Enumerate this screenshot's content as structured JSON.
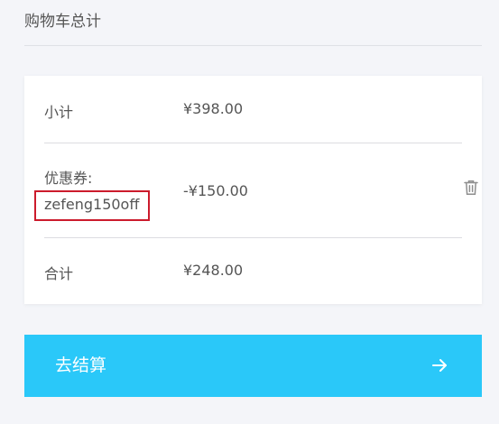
{
  "header": {
    "title": "购物车总计"
  },
  "totals": {
    "subtotal_label": "小计",
    "subtotal_value": "¥398.00",
    "coupon_label": "优惠券:",
    "coupon_code": "zefeng150off",
    "coupon_value": "-¥150.00",
    "total_label": "合计",
    "total_value": "¥248.00"
  },
  "checkout": {
    "label": "去结算"
  },
  "icons": {
    "remove": "trash-icon",
    "proceed": "arrow-right-icon"
  },
  "colors": {
    "accent": "#2ac8f9",
    "highlight_border": "#cc1b2c",
    "background": "#f4f5f9"
  }
}
